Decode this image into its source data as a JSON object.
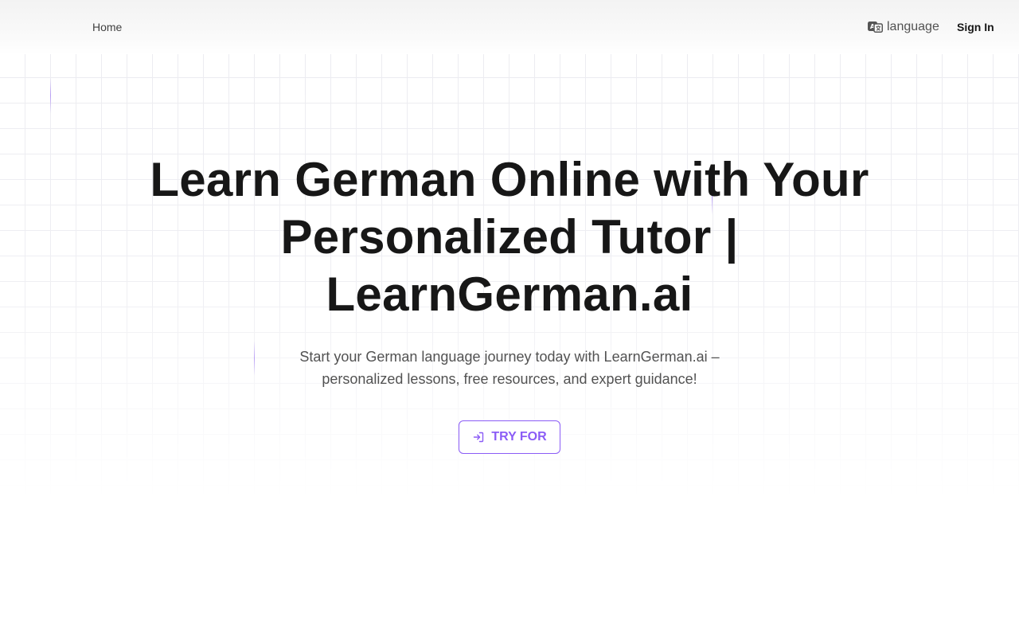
{
  "header": {
    "home_label": "Home",
    "language_label": "language",
    "language_icon": "translate-icon",
    "sign_in_label": "Sign In"
  },
  "hero": {
    "title": "Learn German Online with Your Personalized Tutor | LearnGerman.ai",
    "subtitle": "Start your German language journey today with LearnGerman.ai – personalized lessons, free resources, and expert guidance!",
    "cta_label": "TRY FOR",
    "cta_icon": "sign-in-icon"
  },
  "colors": {
    "accent": "#8b5cf6",
    "text_primary": "#171717",
    "text_secondary": "#525252",
    "grid_line": "#ececf1"
  }
}
